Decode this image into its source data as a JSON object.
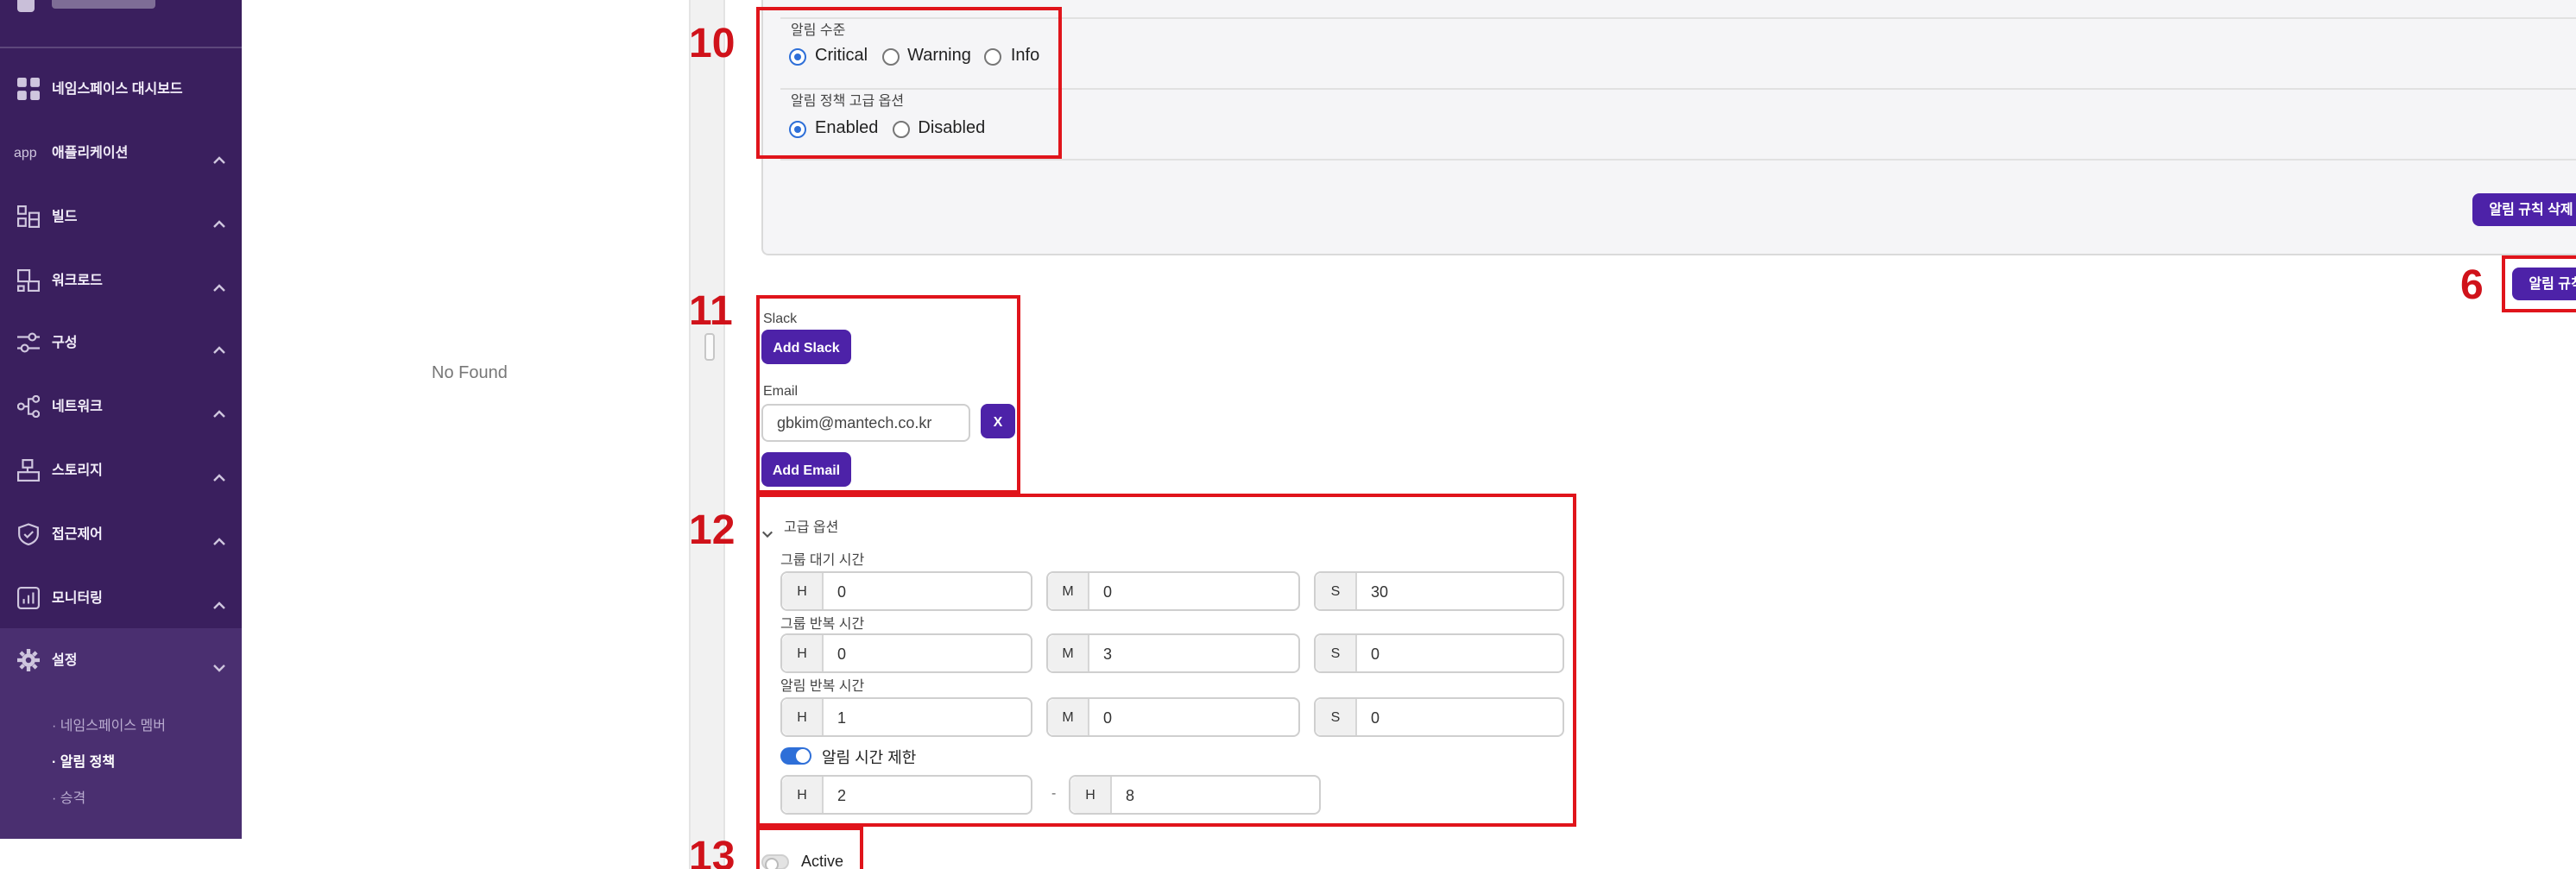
{
  "sidebar": {
    "items": [
      {
        "label": "네임스페이스 대시보드",
        "icon": "grid-icon",
        "chevron": ""
      },
      {
        "label": "애플리케이션",
        "icon": "app-icon",
        "icon_text": "app",
        "chevron": "up"
      },
      {
        "label": "빌드",
        "icon": "build-icon",
        "chevron": "up"
      },
      {
        "label": "워크로드",
        "icon": "workload-icon",
        "chevron": "up"
      },
      {
        "label": "구성",
        "icon": "sliders-icon",
        "chevron": "up"
      },
      {
        "label": "네트워크",
        "icon": "network-icon",
        "chevron": "up"
      },
      {
        "label": "스토리지",
        "icon": "storage-icon",
        "chevron": "up"
      },
      {
        "label": "접근제어",
        "icon": "shield-icon",
        "chevron": "up"
      },
      {
        "label": "모니터링",
        "icon": "chart-icon",
        "chevron": "up"
      },
      {
        "label": "설정",
        "icon": "gear-icon",
        "chevron": "down"
      }
    ],
    "settings_sub": [
      {
        "label": "· 네임스페이스 멤버",
        "active": false
      },
      {
        "label": "· 알림 정책",
        "active": true
      },
      {
        "label": "· 승격",
        "active": false
      }
    ],
    "colors": {
      "bg": "#3a1f5e",
      "active_bg": "#4a2f70"
    }
  },
  "middle": {
    "empty_text": "No Found"
  },
  "rule": {
    "level_label": "알림 수준",
    "level_options": [
      {
        "label": "Critical",
        "selected": true
      },
      {
        "label": "Warning",
        "selected": false
      },
      {
        "label": "Info",
        "selected": false
      }
    ],
    "advanced_label": "알림 정책 고급 옵션",
    "advanced_options": [
      {
        "label": "Enabled",
        "selected": true
      },
      {
        "label": "Disabled",
        "selected": false
      }
    ],
    "delete_button": "알림 규칙 삭제"
  },
  "add_rule_button": "알림 규칙 추가",
  "callouts": {
    "n6": "6",
    "n10": "10",
    "n11": "11",
    "n12": "12",
    "n13": "13"
  },
  "notify": {
    "slack_label": "Slack",
    "add_slack": "Add Slack",
    "email_label": "Email",
    "email_value": "gbkim@mantech.co.kr",
    "remove_label": "X",
    "add_email": "Add Email"
  },
  "advanced": {
    "header": "고급 옵션",
    "group_wait": {
      "label": "그룹 대기 시간",
      "h": "0",
      "m": "0",
      "s": "30"
    },
    "group_repeat": {
      "label": "그룹 반복 시간",
      "h": "0",
      "m": "3",
      "s": "0"
    },
    "alert_repeat": {
      "label": "알림 반복 시간",
      "h": "1",
      "m": "0",
      "s": "0"
    },
    "time_limit": {
      "label": "알림 시간 제한",
      "enabled": true,
      "from_h": "2",
      "separator": "-",
      "to_h": "8"
    },
    "prefix": {
      "h": "H",
      "m": "M",
      "s": "S"
    }
  },
  "active": {
    "label": "Active",
    "enabled": false
  },
  "colors": {
    "accent": "#4d22a8",
    "callout": "#e0141b",
    "toggle_on": "#2e6fd8"
  }
}
